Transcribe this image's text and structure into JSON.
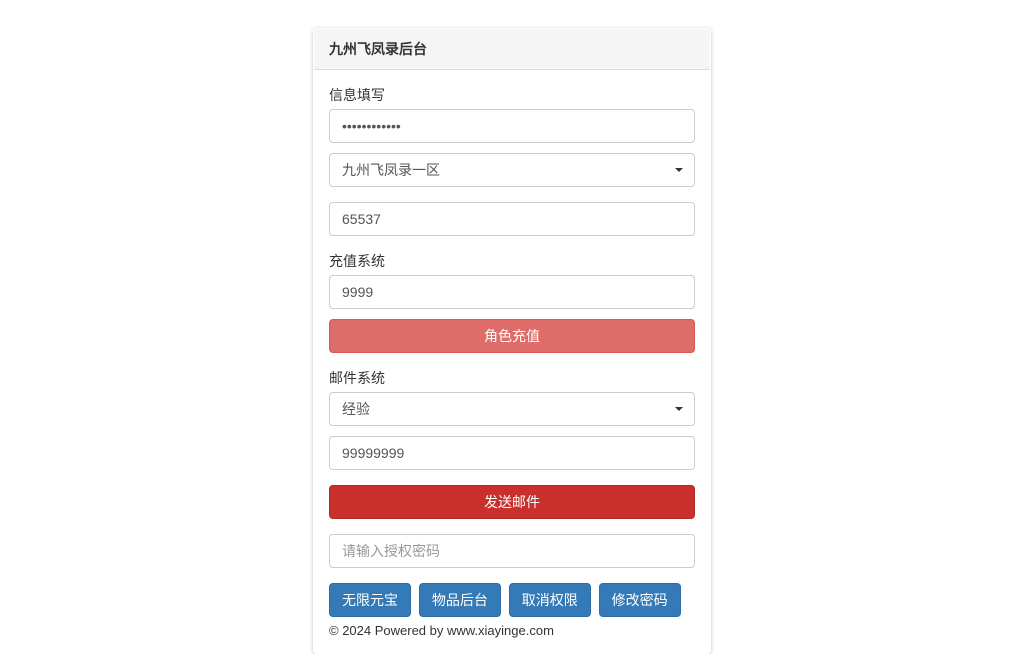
{
  "panel": {
    "title": "九州飞凤录后台"
  },
  "info_section": {
    "label": "信息填写",
    "password_value": "••••••••••••",
    "server_selected": "九州飞凤录一区",
    "number_value": "65537"
  },
  "recharge_section": {
    "label": "充值系统",
    "amount_value": "9999",
    "button_label": "角色充值"
  },
  "mail_section": {
    "label": "邮件系统",
    "type_selected": "经验",
    "qty_value": "99999999",
    "button_label": "发送邮件"
  },
  "auth": {
    "placeholder": "请输入授权密码"
  },
  "buttons": {
    "unlimited_gold": "无限元宝",
    "item_backend": "物品后台",
    "cancel_auth": "取消权限",
    "change_password": "修改密码"
  },
  "footer": "© 2024 Powered by www.xiayinge.com"
}
